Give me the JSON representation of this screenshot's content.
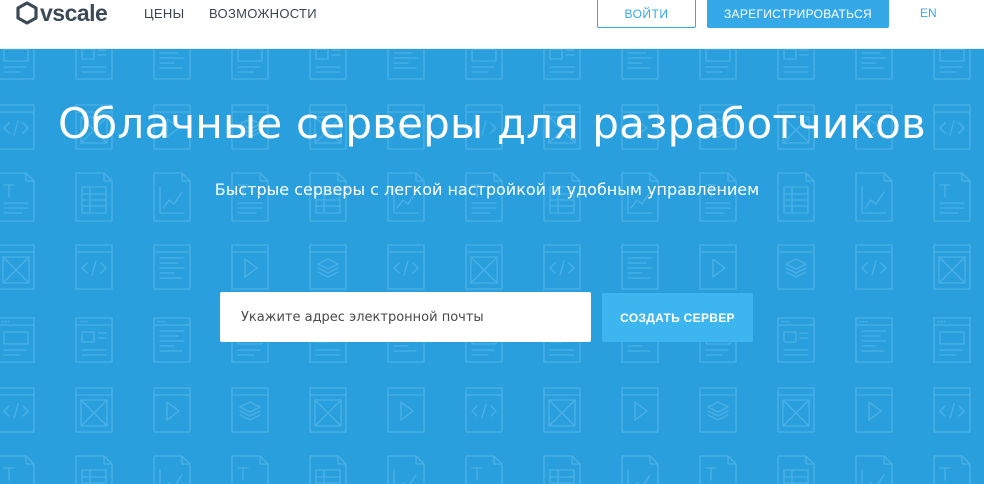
{
  "brand": {
    "name": "vscale",
    "logo_icon": "hexagon-logo-icon",
    "logo_color": "#3b4a56"
  },
  "nav": {
    "links": [
      "ЦЕНЫ",
      "ВОЗМОЖНОСТИ"
    ],
    "login_label": "ВОЙТИ",
    "register_label": "ЗАРЕГИСТРИРОВАТЬСЯ",
    "language": "EN"
  },
  "hero": {
    "title": "Облачные серверы для разработчиков",
    "subtitle": "Быстрые серверы с легкой настройкой и удобным управлением",
    "email_placeholder": "Укажите адрес электронной почты",
    "email_value": "",
    "create_button_label": "СОЗДАТЬ СЕРВЕР"
  },
  "colors": {
    "accent": "#35a9e8",
    "hero_background": "#2a9fde",
    "create_button": "#3db6ef"
  }
}
